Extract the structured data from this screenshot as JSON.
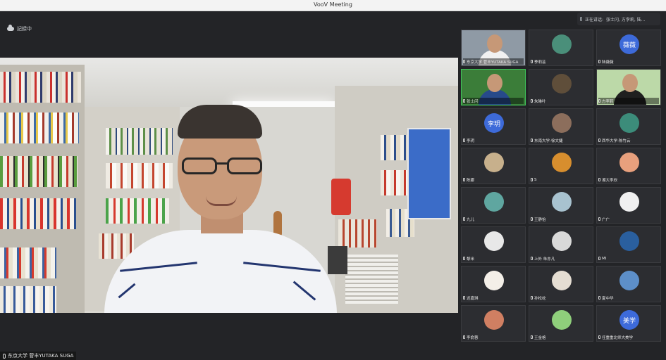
{
  "window": {
    "title": "VooV Meeting"
  },
  "recording": {
    "label": "記録中"
  },
  "main_speaker": {
    "name": "东京大学 菅丰YUTAKA SUGA"
  },
  "speaking": {
    "label": "正在讲话:",
    "names": "张士闪, 方李莉, 陆..."
  },
  "participants": [
    {
      "name": "东京大学 菅丰YUTAKA SUGA",
      "type": "video",
      "bg": "#8f9aa5"
    },
    {
      "name": "季莉芸",
      "type": "avatar",
      "color": "#4a8f7a"
    },
    {
      "name": "陆薇薇",
      "type": "text",
      "initials": "薇薇",
      "color": "#3d6ad9"
    },
    {
      "name": "张士闪",
      "type": "video",
      "bg": "#3b7d39"
    },
    {
      "name": "朱琳叶",
      "type": "avatar",
      "color": "#5f4e3a"
    },
    {
      "name": "方李莉",
      "type": "video",
      "bg": "#bcd9a8"
    },
    {
      "name": "李玥",
      "type": "text",
      "initials": "李玥",
      "color": "#3d6ad9"
    },
    {
      "name": "东南大学-徐文婕",
      "type": "avatar",
      "color": "#8c6e5c"
    },
    {
      "name": "西华大学-陈竹云",
      "type": "avatar",
      "color": "#3c8c7a"
    },
    {
      "name": "陈娜",
      "type": "avatar",
      "color": "#c7b08c"
    },
    {
      "name": "S",
      "type": "avatar",
      "color": "#d78e2e"
    },
    {
      "name": "湘大李欣",
      "type": "avatar",
      "color": "#e8a07d"
    },
    {
      "name": "九儿",
      "type": "avatar",
      "color": "#5fa6a0"
    },
    {
      "name": "王静怡",
      "type": "avatar",
      "color": "#a8c2cf"
    },
    {
      "name": "广广",
      "type": "avatar",
      "color": "#f0f0f0"
    },
    {
      "name": "黎米",
      "type": "avatar",
      "color": "#e8e8e8"
    },
    {
      "name": "上外 朱亦凡",
      "type": "avatar",
      "color": "#d9d9d9"
    },
    {
      "name": "MI",
      "type": "avatar",
      "color": "#2a5f9e"
    },
    {
      "name": "迟嘉琪",
      "type": "avatar",
      "color": "#f4efe8"
    },
    {
      "name": "孙松屹",
      "type": "avatar",
      "color": "#e5ddd2"
    },
    {
      "name": "夏中华",
      "type": "avatar",
      "color": "#5d8fc9"
    },
    {
      "name": "李俞蓉",
      "type": "avatar",
      "color": "#d07f62"
    },
    {
      "name": "王金格",
      "type": "avatar",
      "color": "#8fcf7b"
    },
    {
      "name": "任重重北师大美学",
      "type": "text",
      "initials": "美学",
      "color": "#3d6ad9"
    }
  ]
}
